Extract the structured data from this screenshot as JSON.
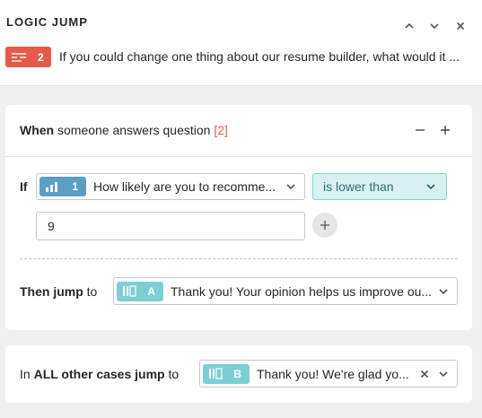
{
  "header": {
    "title": "LOGIC JUMP",
    "controls": {
      "up": "chevron-up-icon",
      "down": "chevron-down-icon",
      "close": "close-icon"
    }
  },
  "question": {
    "number": "2",
    "text": "If you could change one thing about our resume builder, what would it ...",
    "badge_color": "#e65a4b",
    "icon": "long-text-icon"
  },
  "rule": {
    "when_bold": "When",
    "when_text": " someone answers question ",
    "question_ref": "[2]",
    "if_label": "If",
    "field": {
      "number": "1",
      "text": "How likely are you to recomme...",
      "icon": "opinion-scale-icon",
      "chip_color": "#5b9fc5"
    },
    "condition": "is lower than",
    "value": "9",
    "then_bold": "Then jump",
    "then_text": " to",
    "target": {
      "letter": "A",
      "text": "Thank you! Your opinion helps us improve ou...",
      "icon": "ending-icon",
      "chip_color": "#7ecfd3"
    }
  },
  "else_rule": {
    "prefix": "In ",
    "bold": "ALL other cases jump",
    "suffix": " to",
    "target": {
      "letter": "B",
      "text": "Thank you! We're glad yo...",
      "icon": "ending-icon",
      "chip_color": "#7ecfd3"
    }
  }
}
